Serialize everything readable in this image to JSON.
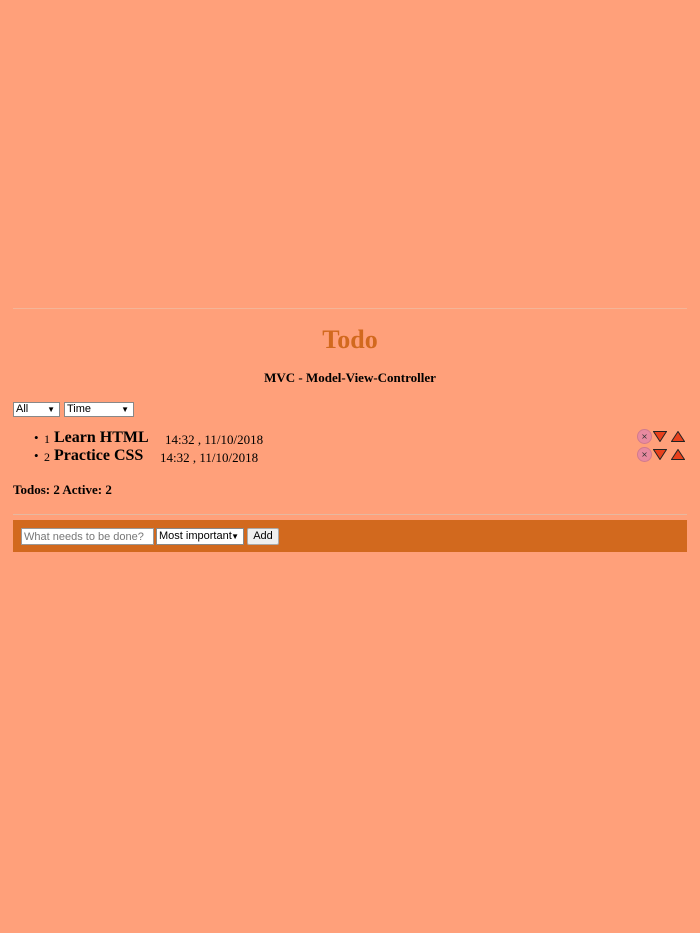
{
  "header": {
    "title": "Todo",
    "subtitle": "MVC - Model-View-Controller"
  },
  "filters": {
    "status_selected": "All",
    "sort_selected": "Time"
  },
  "todos": [
    {
      "number": "1",
      "name": "Learn HTML",
      "time": "14:32 , 11/10/2018",
      "delete_glyph": "×"
    },
    {
      "number": "2",
      "name": "Practice CSS",
      "time": "14:32 , 11/10/2018",
      "delete_glyph": "×"
    }
  ],
  "stats": {
    "text": "Todos: 2 Active: 2"
  },
  "new_todo": {
    "placeholder": "What needs to be done?",
    "value": "",
    "priority_selected": "Most important",
    "add_label": "Add"
  },
  "icons": {
    "delete": "close-icon",
    "move_down": "triangle-down-icon",
    "move_up": "triangle-up-icon",
    "select_arrow": "▼"
  },
  "colors": {
    "background": "#FFA07A",
    "accent": "#D2691E",
    "delete_button": "#E88AA0",
    "arrow_fill": "#E8401C"
  }
}
